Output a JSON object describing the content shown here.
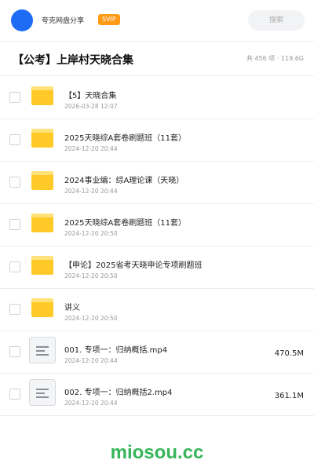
{
  "topbar": {
    "username": "夸克网盘分享",
    "badge": "SVIP",
    "search_placeholder": "搜索"
  },
  "header": {
    "title": "【公考】上岸村天晓合集",
    "meta": "共 456 项 · 119.6G"
  },
  "items": [
    {
      "type": "folder",
      "name": "【5】天晓合集",
      "date": "2026-03-28 12:07",
      "size": ""
    },
    {
      "type": "folder",
      "name": "2025天晓综A套卷刷题班（11套）",
      "date": "2024-12-20 20:44",
      "size": ""
    },
    {
      "type": "folder",
      "name": "2024事业编：综A理论课（天晓）",
      "date": "2024-12-20 20:44",
      "size": ""
    },
    {
      "type": "folder",
      "name": "2025天晓综A套卷刷题班（11套）",
      "date": "2024-12-20 20:50",
      "size": ""
    },
    {
      "type": "folder",
      "name": "【申论】2025省考天晓申论专项刷题班",
      "date": "2024-12-20 20:50",
      "size": ""
    },
    {
      "type": "folder",
      "name": "讲义",
      "date": "2024-12-20 20:50",
      "size": ""
    },
    {
      "type": "file",
      "name": "001. 专项一：归纳概括.mp4",
      "date": "2024-12-20 20:44",
      "size": "470.5M"
    },
    {
      "type": "file",
      "name": "002. 专项一：归纳概括2.mp4",
      "date": "2024-12-20 20:44",
      "size": "361.1M"
    }
  ],
  "watermark": "miosou.cc",
  "colors": {
    "avatar": "#1e6cf5",
    "badge": "#ff9a17",
    "folder": "#ffc928",
    "watermark": "#36b55a"
  },
  "icons": {
    "folder": "folder-icon",
    "file": "document-icon"
  }
}
